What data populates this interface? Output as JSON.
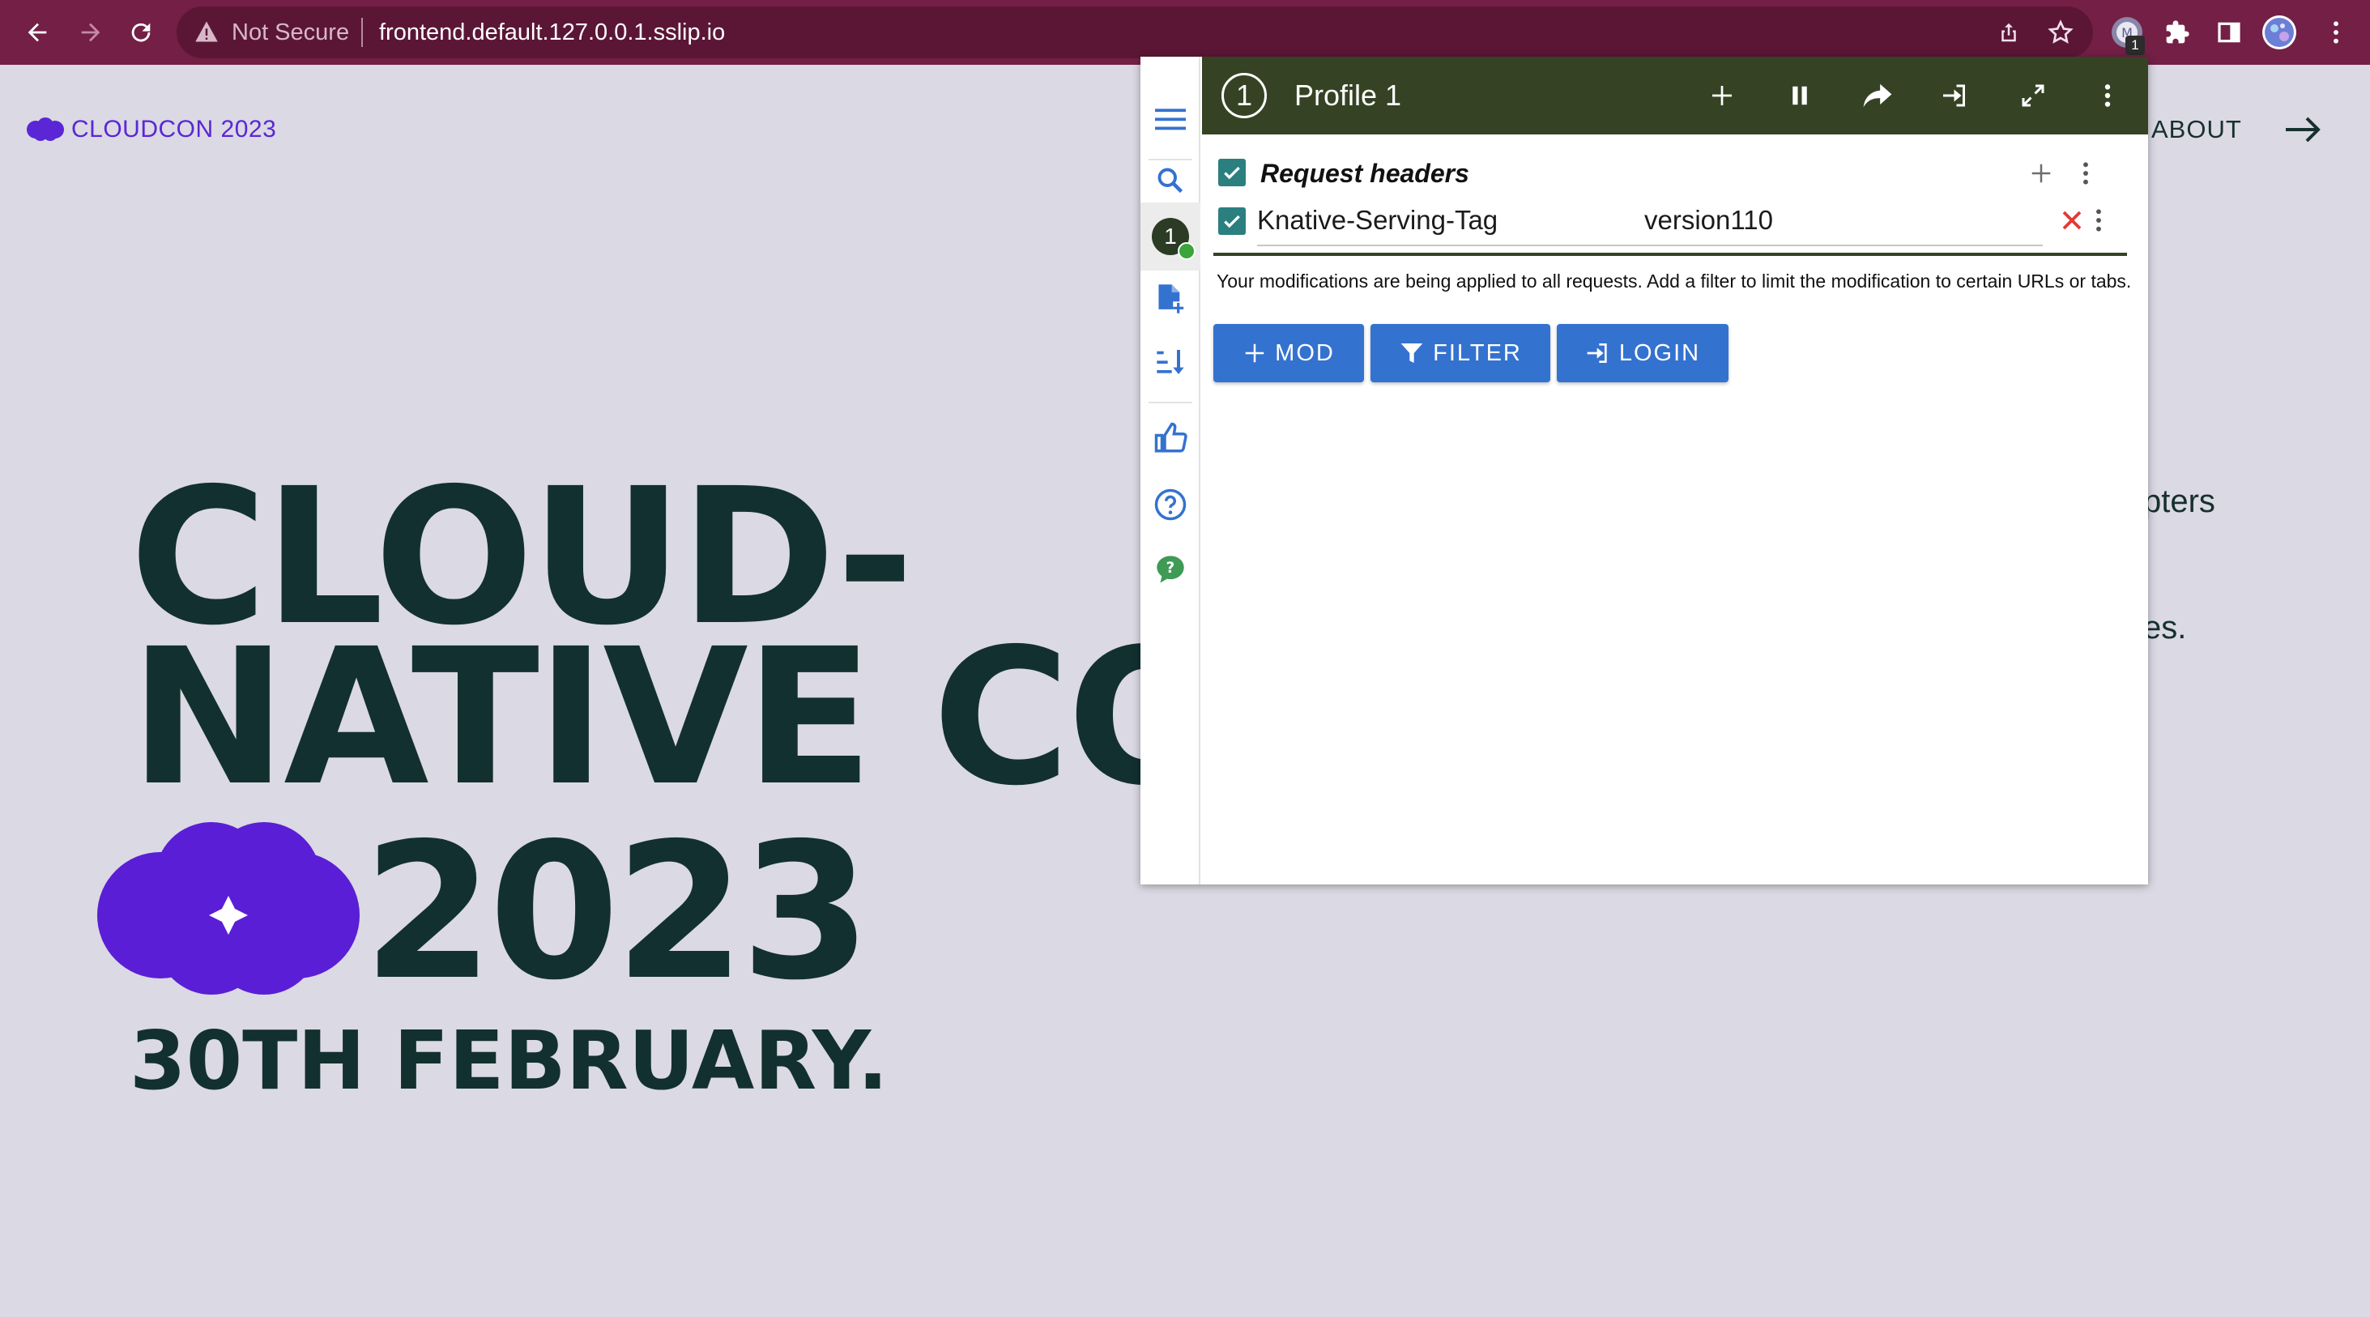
{
  "browser": {
    "security_label": "Not Secure",
    "url": "frontend.default.127.0.0.1.sslip.io",
    "extension_badge": "1"
  },
  "site": {
    "brand": "CLOUDCON 2023",
    "nav_about": "ABOUT",
    "side_fragment_1": "pters",
    "side_fragment_2": "es.",
    "hero_line1": "CLOUD-",
    "hero_line2": "NATIVE CON",
    "hero_year": "2023",
    "hero_date": "30TH FEBRUARY."
  },
  "extension": {
    "profile_number": "1",
    "profile_title": "Profile 1",
    "section_title": "Request headers",
    "header_row": {
      "name": "Knative-Serving-Tag",
      "value": "version110",
      "enabled": true
    },
    "notice": "Your modifications are being applied to all requests. Add a filter to limit the modification to certain URLs or tabs.",
    "buttons": {
      "mod": "MOD",
      "filter": "FILTER",
      "login": "LOGIN"
    },
    "rail_profile_number": "1"
  },
  "colors": {
    "toolbar": "#741f46",
    "page_bg": "#dbd9e3",
    "brand": "#5a26d6",
    "hero_text": "#12302f",
    "ext_header": "#354324",
    "ext_button": "#3472cf"
  }
}
